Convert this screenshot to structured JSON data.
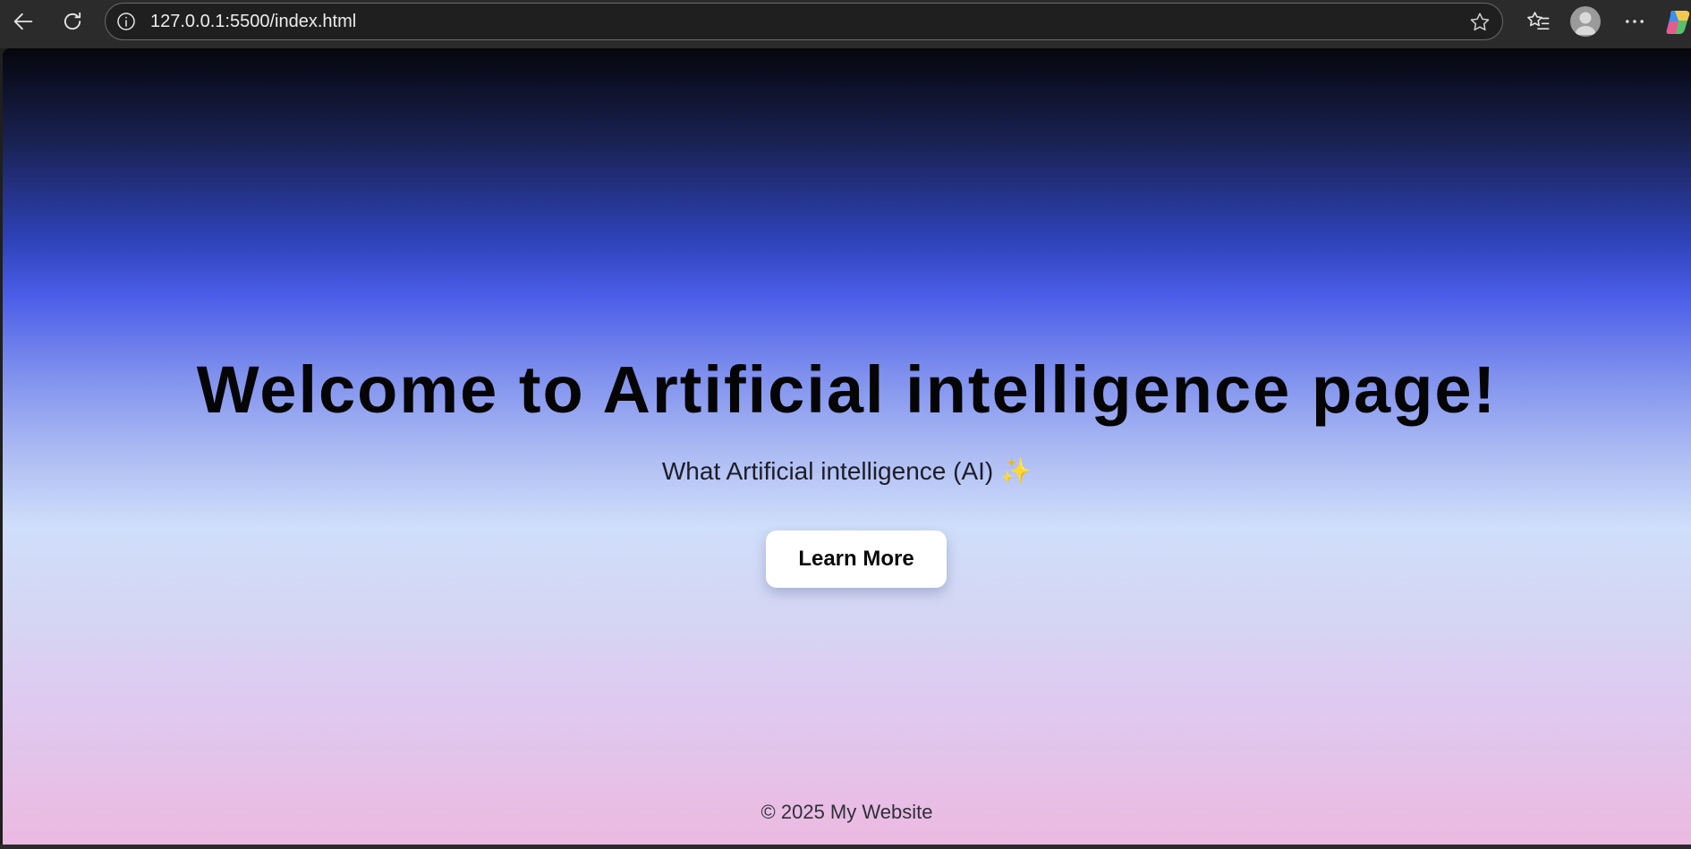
{
  "browser": {
    "url": "127.0.0.1:5500/index.html",
    "icons": {
      "back": "back-arrow-icon",
      "reload": "reload-icon",
      "site_info": "info-icon",
      "favorite": "star-icon",
      "favorites_list": "favorites-icon",
      "profile": "profile-avatar-icon",
      "menu": "more-icon",
      "copilot": "copilot-icon"
    }
  },
  "page": {
    "title": "Welcome to Artificial intelligence page!",
    "subtitle": "What Artificial intelligence (AI)",
    "subtitle_emoji": "✨",
    "cta_label": "Learn More",
    "footer": "© 2025 My Website",
    "colors": {
      "gradient_top": "#05060c",
      "gradient_mid_blue": "#4a5de8",
      "gradient_light": "#cfdefa",
      "gradient_bottom": "#ecb9e1",
      "button_bg": "#ffffff"
    }
  }
}
